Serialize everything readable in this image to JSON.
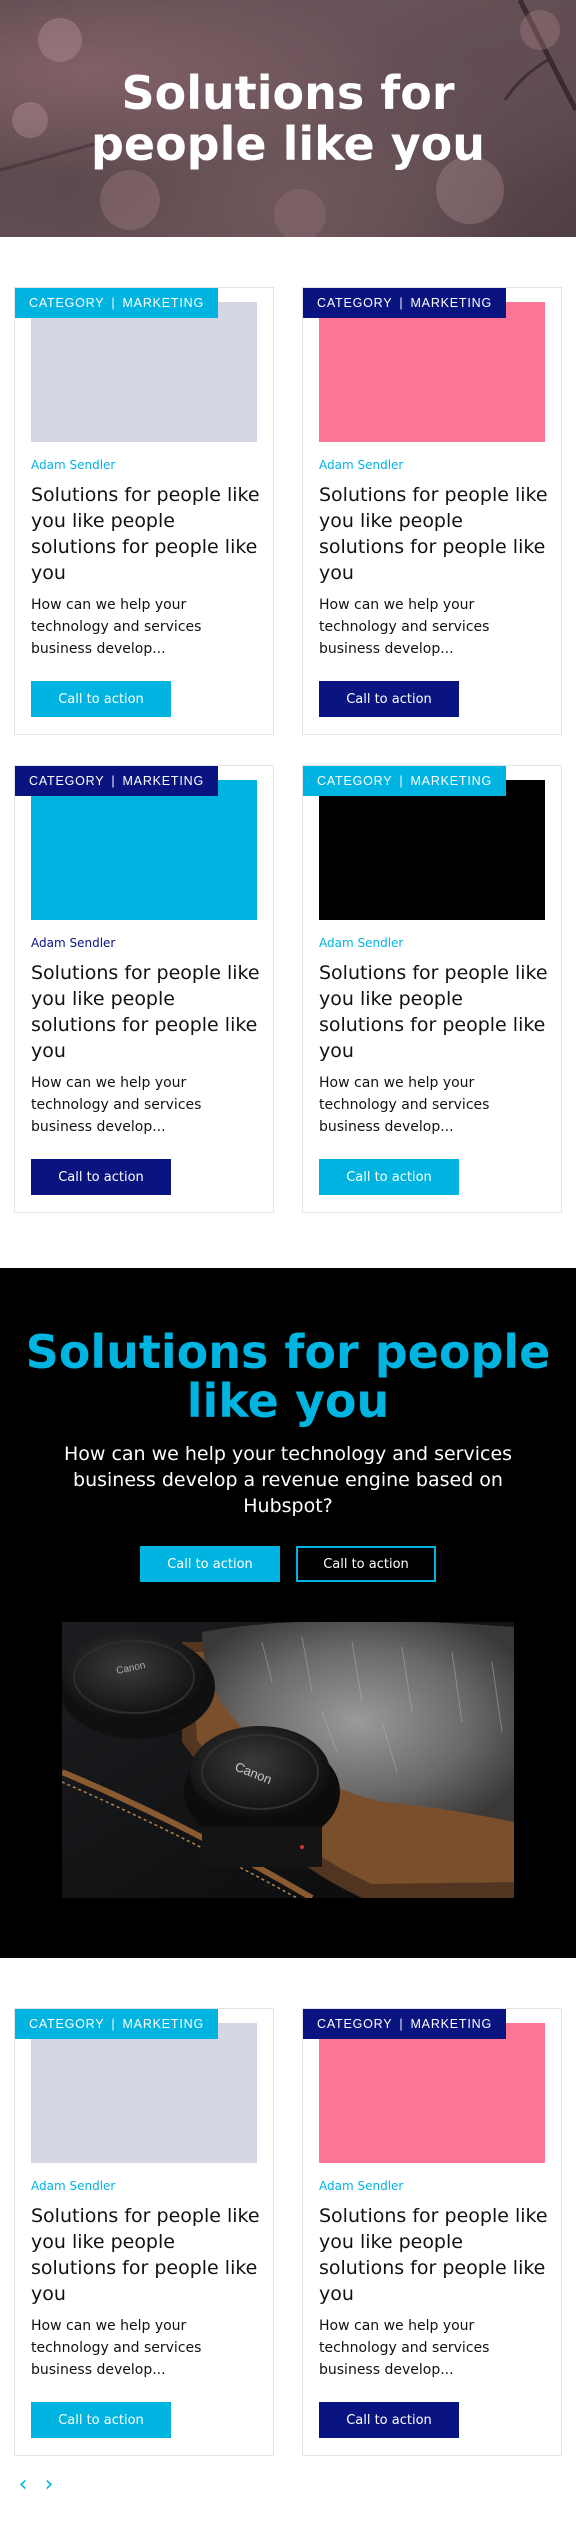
{
  "hero": {
    "title": "Solutions for people like you"
  },
  "colors": {
    "cyan": "#00b4e1",
    "navy": "#0a1481",
    "thumb_gray": "#d5d8e4",
    "thumb_pink": "#ff7596",
    "thumb_cyan": "#00b4e1",
    "thumb_black": "#000000"
  },
  "card_common": {
    "tag_category": "CATEGORY",
    "tag_separator": "|",
    "tag_topic": "MARKETING",
    "author": "Adam Sendler",
    "title": "Solutions for people like you like people solutions for people like you",
    "excerpt": "How can we help your technology and services business develop...",
    "cta_label": "Call to action"
  },
  "cards_top": [
    {
      "tag_color": "cyan",
      "thumb_color": "thumb_gray",
      "author_color": "cyan",
      "cta_color": "cyan"
    },
    {
      "tag_color": "navy",
      "thumb_color": "thumb_pink",
      "author_color": "cyan",
      "cta_color": "navy"
    },
    {
      "tag_color": "navy",
      "thumb_color": "thumb_cyan",
      "author_color": "navy",
      "cta_color": "navy"
    },
    {
      "tag_color": "cyan",
      "thumb_color": "thumb_black",
      "author_color": "cyan",
      "cta_color": "cyan"
    }
  ],
  "feature": {
    "title": "Solutions for people like you",
    "body": "How can we help your technology and services business develop a revenue engine based on Hubspot?",
    "primary_cta": "Call to action",
    "secondary_cta": "Call to action",
    "lens_brand": "Canon"
  },
  "cards_bottom": [
    {
      "tag_color": "cyan",
      "thumb_color": "thumb_gray",
      "author_color": "cyan",
      "cta_color": "cyan"
    },
    {
      "tag_color": "navy",
      "thumb_color": "thumb_pink",
      "author_color": "cyan",
      "cta_color": "navy"
    }
  ],
  "pager": {
    "prev_icon": "chevron-left-icon",
    "next_icon": "chevron-right-icon",
    "prev_glyph": "‹",
    "next_glyph": "›"
  }
}
